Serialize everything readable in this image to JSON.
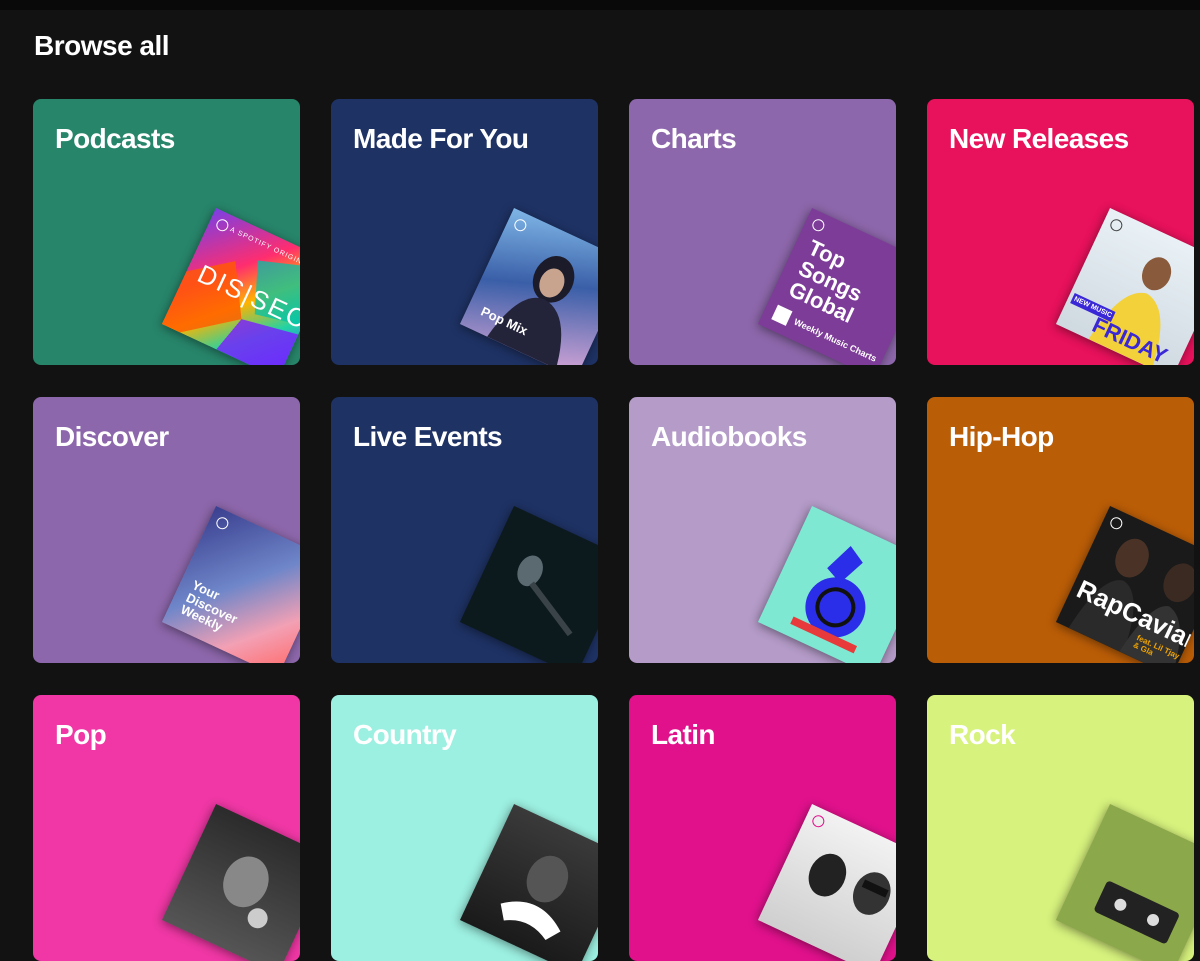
{
  "section": {
    "title": "Browse all"
  },
  "cards": [
    {
      "title": "Podcasts",
      "color": "#27856a",
      "art": {
        "top_text": "A SPOTIFY ORIGINAL",
        "text": "DIS|SECT"
      }
    },
    {
      "title": "Made For You",
      "color": "#1e3264",
      "art": {
        "text": "Pop Mix"
      }
    },
    {
      "title": "Charts",
      "color": "#8d67ab",
      "art": {
        "text": "Top Songs Global",
        "sub": "Weekly Music Charts"
      }
    },
    {
      "title": "New Releases",
      "color": "#e8115b",
      "art": {
        "text": "FRIDAY",
        "sub": "NEW MUSIC"
      }
    },
    {
      "title": "Discover",
      "color": "#8d67ab",
      "art": {
        "text": "Your Discover Weekly"
      }
    },
    {
      "title": "Live Events",
      "color": "#1e3264",
      "art": {}
    },
    {
      "title": "Audiobooks",
      "color": "#b49bc8",
      "art": {}
    },
    {
      "title": "Hip-Hop",
      "color": "#ba5d07",
      "art": {
        "text": "RapCaviar",
        "sub": "feat. Lil Tjay & Gla"
      }
    },
    {
      "title": "Pop",
      "color": "#f037a5",
      "art": {}
    },
    {
      "title": "Country",
      "color": "#9cf0e1",
      "art": {}
    },
    {
      "title": "Latin",
      "color": "#e1118c",
      "art": {}
    },
    {
      "title": "Rock",
      "color": "#d7f27d",
      "art": {}
    }
  ]
}
